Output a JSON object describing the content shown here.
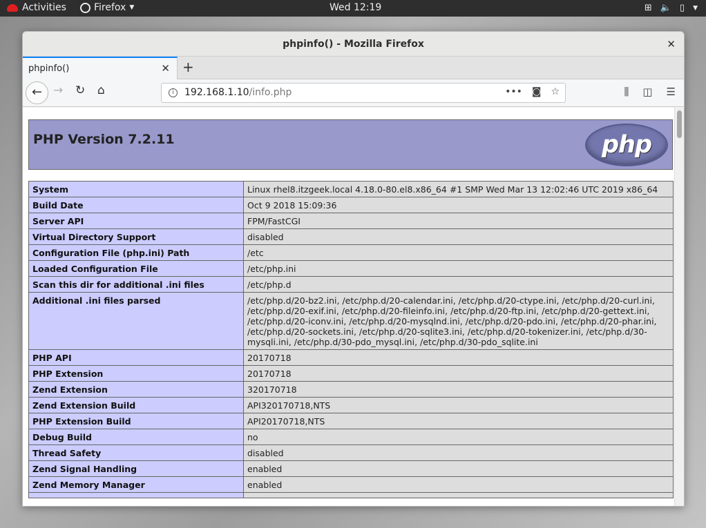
{
  "topbar": {
    "activities": "Activities",
    "app_menu": "Firefox",
    "clock": "Wed 12:19"
  },
  "window": {
    "title": "phpinfo() - Mozilla Firefox"
  },
  "tabs": [
    {
      "label": "phpinfo()"
    }
  ],
  "urlbar": {
    "host": "192.168.1.10",
    "path": "/info.php"
  },
  "page": {
    "heading": "PHP Version 7.2.11",
    "logo_text": "php",
    "rows": [
      {
        "key": "System",
        "value": "Linux rhel8.itzgeek.local 4.18.0-80.el8.x86_64 #1 SMP Wed Mar 13 12:02:46 UTC 2019 x86_64"
      },
      {
        "key": "Build Date",
        "value": "Oct 9 2018 15:09:36"
      },
      {
        "key": "Server API",
        "value": "FPM/FastCGI"
      },
      {
        "key": "Virtual Directory Support",
        "value": "disabled"
      },
      {
        "key": "Configuration File (php.ini) Path",
        "value": "/etc"
      },
      {
        "key": "Loaded Configuration File",
        "value": "/etc/php.ini"
      },
      {
        "key": "Scan this dir for additional .ini files",
        "value": "/etc/php.d"
      },
      {
        "key": "Additional .ini files parsed",
        "value": "/etc/php.d/20-bz2.ini, /etc/php.d/20-calendar.ini, /etc/php.d/20-ctype.ini, /etc/php.d/20-curl.ini, /etc/php.d/20-exif.ini, /etc/php.d/20-fileinfo.ini, /etc/php.d/20-ftp.ini, /etc/php.d/20-gettext.ini, /etc/php.d/20-iconv.ini, /etc/php.d/20-mysqlnd.ini, /etc/php.d/20-pdo.ini, /etc/php.d/20-phar.ini, /etc/php.d/20-sockets.ini, /etc/php.d/20-sqlite3.ini, /etc/php.d/20-tokenizer.ini, /etc/php.d/30-mysqli.ini, /etc/php.d/30-pdo_mysql.ini, /etc/php.d/30-pdo_sqlite.ini"
      },
      {
        "key": "PHP API",
        "value": "20170718"
      },
      {
        "key": "PHP Extension",
        "value": "20170718"
      },
      {
        "key": "Zend Extension",
        "value": "320170718"
      },
      {
        "key": "Zend Extension Build",
        "value": "API320170718,NTS"
      },
      {
        "key": "PHP Extension Build",
        "value": "API20170718,NTS"
      },
      {
        "key": "Debug Build",
        "value": "no"
      },
      {
        "key": "Thread Safety",
        "value": "disabled"
      },
      {
        "key": "Zend Signal Handling",
        "value": "enabled"
      },
      {
        "key": "Zend Memory Manager",
        "value": "enabled"
      },
      {
        "key": "",
        "value": ""
      }
    ]
  },
  "colors": {
    "header_bg": "#9999cc",
    "key_bg": "#ccccff",
    "value_bg": "#dddddd",
    "tab_accent": "#0a84ff"
  },
  "icons": [
    "redhat-icon",
    "firefox-icon",
    "network-icon",
    "volume-icon",
    "battery-icon",
    "power-icon",
    "back-icon",
    "forward-icon",
    "reload-icon",
    "home-icon",
    "info-icon",
    "more-icon",
    "pocket-icon",
    "star-icon",
    "library-icon",
    "sidebar-icon",
    "menu-icon"
  ]
}
